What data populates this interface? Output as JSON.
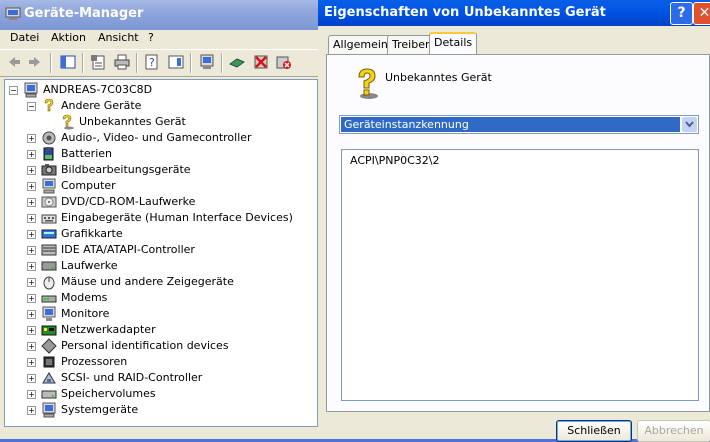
{
  "device_manager": {
    "title": "Geräte-Manager",
    "menu": [
      "Datei",
      "Aktion",
      "Ansicht",
      "?"
    ],
    "toolbar_icons": [
      "back-arrow-icon",
      "forward-arrow-icon",
      "show-hide-tree-icon",
      "properties-icon",
      "print-icon",
      "help-icon",
      "show-hide-icon",
      "scan-hardware-icon",
      "update-driver-icon",
      "uninstall-icon",
      "disable-icon"
    ],
    "tree": {
      "root": "ANDREAS-7C03C8D",
      "items": [
        {
          "label": "Andere Geräte",
          "expanded": true,
          "icon": "question-mark-icon"
        },
        {
          "label": "Unbekanntes Gerät",
          "child": true,
          "icon": "unknown-device-icon"
        },
        {
          "label": "Audio-, Video- und Gamecontroller",
          "icon": "speaker-icon"
        },
        {
          "label": "Batterien",
          "icon": "battery-icon"
        },
        {
          "label": "Bildbearbeitungsgeräte",
          "icon": "camera-icon"
        },
        {
          "label": "Computer",
          "icon": "computer-icon"
        },
        {
          "label": "DVD/CD-ROM-Laufwerke",
          "icon": "cdrom-icon"
        },
        {
          "label": "Eingabegeräte (Human Interface Devices)",
          "icon": "hid-icon"
        },
        {
          "label": "Grafikkarte",
          "icon": "display-adapter-icon"
        },
        {
          "label": "IDE ATA/ATAPI-Controller",
          "icon": "ide-controller-icon"
        },
        {
          "label": "Laufwerke",
          "icon": "disk-drive-icon"
        },
        {
          "label": "Mäuse und andere Zeigegeräte",
          "icon": "mouse-icon"
        },
        {
          "label": "Modems",
          "icon": "modem-icon"
        },
        {
          "label": "Monitore",
          "icon": "monitor-icon"
        },
        {
          "label": "Netzwerkadapter",
          "icon": "network-adapter-icon"
        },
        {
          "label": "Personal identification devices",
          "icon": "id-device-icon"
        },
        {
          "label": "Prozessoren",
          "icon": "processor-icon"
        },
        {
          "label": "SCSI- und RAID-Controller",
          "icon": "scsi-icon"
        },
        {
          "label": "Speichervolumes",
          "icon": "storage-volume-icon"
        },
        {
          "label": "Systemgeräte",
          "icon": "system-device-icon"
        }
      ]
    }
  },
  "properties": {
    "title": "Eigenschaften von Unbekanntes Gerät",
    "tabs": [
      "Allgemein",
      "Treiber",
      "Details"
    ],
    "active_tab": "Details",
    "device_name": "Unbekanntes Gerät",
    "dropdown_value": "Geräteinstanzkennung",
    "value": "ACPI\\PNP0C32\\2",
    "buttons": {
      "close": "Schließen",
      "cancel": "Abbrechen"
    }
  },
  "colors": {
    "accent_blue": "#0055e5",
    "selection": "#316ac5",
    "window_bg": "#ece9d8"
  }
}
